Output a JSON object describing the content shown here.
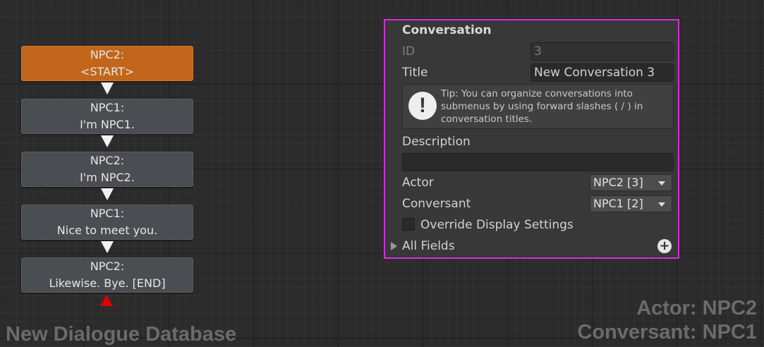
{
  "canvas": {
    "database_name": "New Dialogue Database",
    "actor_label": "Actor: NPC2",
    "conversant_label": "Conversant: NPC1"
  },
  "nodes": [
    {
      "speaker": "NPC2:",
      "text": "<START>"
    },
    {
      "speaker": "NPC1:",
      "text": "I'm NPC1."
    },
    {
      "speaker": "NPC2:",
      "text": "I'm NPC2."
    },
    {
      "speaker": "NPC1:",
      "text": "Nice to meet you."
    },
    {
      "speaker": "NPC2:",
      "text": "Likewise. Bye. [END]"
    }
  ],
  "inspector": {
    "header": "Conversation",
    "id_label": "ID",
    "id_value": "3",
    "title_label": "Title",
    "title_value": "New Conversation 3",
    "tip": "Tip: You can organize conversations into submenus by using forward slashes ( / ) in conversation titles.",
    "description_label": "Description",
    "description_value": "",
    "actor_label": "Actor",
    "actor_value": "NPC2 [3]",
    "conversant_label": "Conversant",
    "conversant_value": "NPC1 [2]",
    "override_label": "Override Display Settings",
    "override_checked": false,
    "all_fields_label": "All Fields"
  },
  "colors": {
    "start_node": "#c1661a",
    "node": "#4a4d51",
    "selection_border": "#d22fd9",
    "end_marker": "#e00000"
  },
  "icons": {
    "tip": "exclamation-circle-icon",
    "add": "plus-circle-icon",
    "foldout": "triangle-right-icon",
    "dropdown": "chevron-down-icon"
  }
}
